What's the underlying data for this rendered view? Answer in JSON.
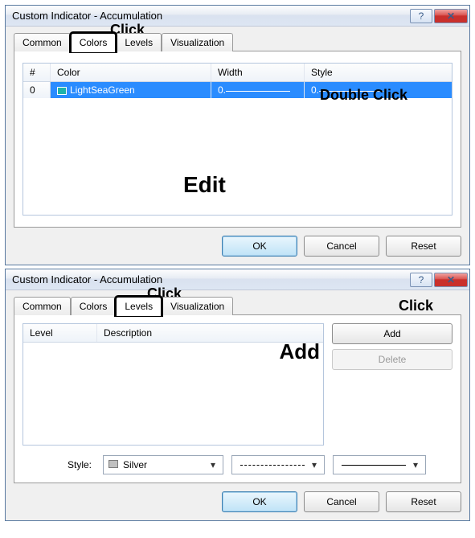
{
  "dialog1": {
    "title": "Custom Indicator - Accumulation",
    "help_label": "?",
    "close_label": "✕",
    "tabs": {
      "common": "Common",
      "colors": "Colors",
      "levels": "Levels",
      "viz": "Visualization"
    },
    "columns": {
      "idx": "#",
      "color": "Color",
      "width": "Width",
      "style": "Style"
    },
    "row": {
      "idx": "0",
      "name": "LightSeaGreen",
      "widthPrefix": "0.",
      "stylePrefix": "0."
    },
    "buttons": {
      "ok": "OK",
      "cancel": "Cancel",
      "reset": "Reset"
    },
    "annotations": {
      "click_tab": "Click",
      "dbl": "Double Click",
      "edit": "Edit"
    }
  },
  "dialog2": {
    "title": "Custom Indicator - Accumulation",
    "help_label": "?",
    "close_label": "✕",
    "tabs": {
      "common": "Common",
      "colors": "Colors",
      "levels": "Levels",
      "viz": "Visualization"
    },
    "columns": {
      "level": "Level",
      "desc": "Description"
    },
    "buttons": {
      "add": "Add",
      "delete": "Delete",
      "ok": "OK",
      "cancel": "Cancel",
      "reset": "Reset"
    },
    "style": {
      "label": "Style:",
      "selected": "Silver"
    },
    "annotations": {
      "click_tab": "Click",
      "click_add": "Click",
      "add_big": "Add"
    }
  }
}
